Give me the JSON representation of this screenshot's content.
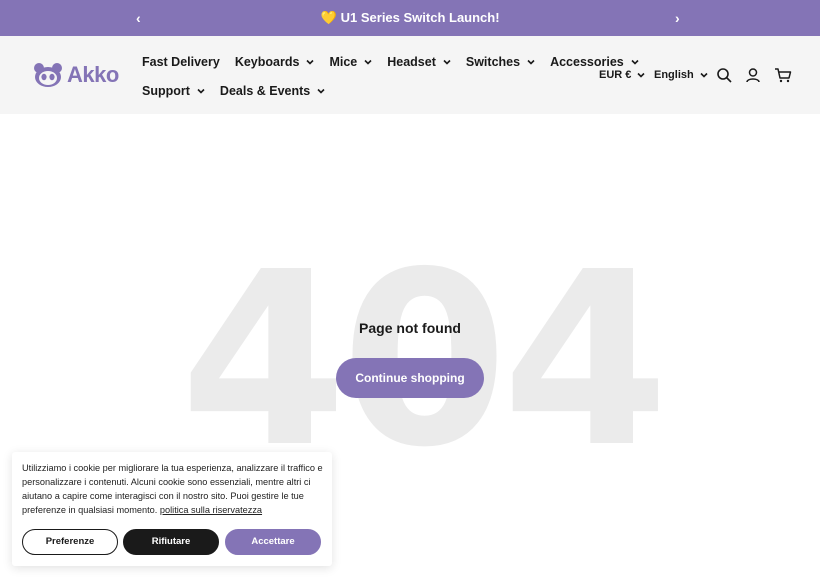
{
  "announcement": {
    "prev_label": "‹",
    "next_label": "›",
    "message": "U1 Series Switch Launch!",
    "heart": "💛"
  },
  "brand": {
    "name": "Akko",
    "color": "#8474b6"
  },
  "nav": {
    "row1": [
      {
        "label": "Fast Delivery",
        "dropdown": false
      },
      {
        "label": "Keyboards",
        "dropdown": true
      },
      {
        "label": "Mice",
        "dropdown": true
      },
      {
        "label": "Headset",
        "dropdown": true
      },
      {
        "label": "Switches",
        "dropdown": true
      },
      {
        "label": "Accessories",
        "dropdown": true
      }
    ],
    "row2": [
      {
        "label": "Support",
        "dropdown": true
      },
      {
        "label": "Deals & Events",
        "dropdown": true
      }
    ]
  },
  "utility": {
    "currency": "EUR €",
    "language": "English",
    "icons": [
      "search-icon",
      "account-icon",
      "cart-icon"
    ]
  },
  "error_page": {
    "code": "404",
    "title": "Page not found",
    "cta": "Continue shopping"
  },
  "cookie_banner": {
    "text": "Utilizziamo i cookie per migliorare la tua esperienza, analizzare il traffico e personalizzare i contenuti. Alcuni cookie sono essenziali, mentre altri ci aiutano a capire come interagisci con il nostro sito. Puoi gestire le tue preferenze in qualsiasi momento.",
    "policy_link": "politica sulla riservatezza",
    "preferences": "Preferenze",
    "reject": "Rifiutare",
    "accept": "Accettare"
  },
  "colors": {
    "accent": "#8474b6",
    "header_bg": "#f5f5f5",
    "big_404": "#ebebeb"
  }
}
